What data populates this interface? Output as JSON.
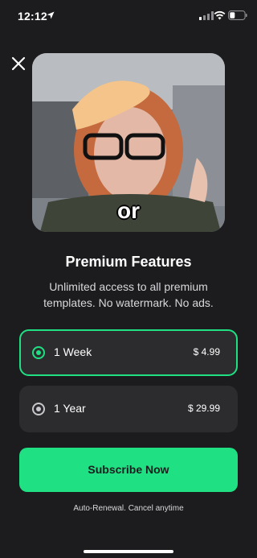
{
  "status_bar": {
    "time": "12:12"
  },
  "preview": {
    "caption": "or"
  },
  "paywall": {
    "title": "Premium Features",
    "subtitle": "Unlimited access to all premium templates. No watermark. No ads."
  },
  "plans": [
    {
      "label": "1 Week",
      "price": "$ 4.99",
      "selected": true
    },
    {
      "label": "1 Year",
      "price": "$ 29.99",
      "selected": false
    }
  ],
  "cta": {
    "label": "Subscribe Now"
  },
  "footer": {
    "note": "Auto-Renewal. Cancel anytime"
  },
  "colors": {
    "accent": "#1fe083",
    "background": "#1c1c1e",
    "card": "#2c2c2e"
  },
  "icons": {
    "location": "location-arrow-icon",
    "signal": "cellular-signal-icon",
    "wifi": "wifi-icon",
    "battery": "battery-icon",
    "close": "close-icon"
  }
}
